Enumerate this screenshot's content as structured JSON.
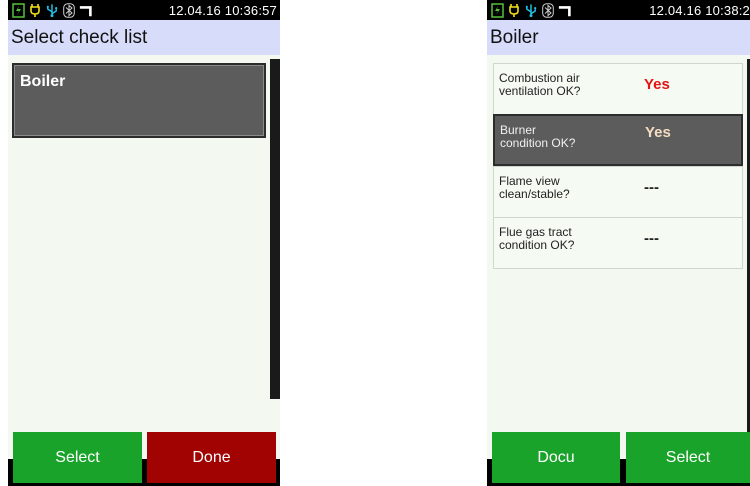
{
  "colors": {
    "green_button": "#1aa32a",
    "red_button": "#a10303",
    "title_bar": "#d8dcfb",
    "content_bg": "#f3f8f1",
    "answer_yes": "#e41414",
    "selected_row": "#5c5c5c"
  },
  "left_screen": {
    "status_icons": [
      "battery-charging-icon",
      "plug-icon",
      "usb-icon",
      "bluetooth-icon",
      "probe-icon"
    ],
    "datetime": "12.04.16 10:36:57",
    "title": "Select check list",
    "items": [
      {
        "label": "Boiler",
        "selected": true
      }
    ],
    "softkeys": {
      "left": "Select",
      "right": "Done"
    }
  },
  "right_screen": {
    "status_icons": [
      "battery-charging-icon",
      "plug-icon",
      "usb-icon",
      "bluetooth-icon",
      "probe-icon"
    ],
    "datetime": "12.04.16 10:38:2",
    "title": "Boiler",
    "checklist": [
      {
        "question_line1": "Combustion air",
        "question_line2": "ventilation OK?",
        "answer": "Yes",
        "selected": false
      },
      {
        "question_line1": "Burner",
        "question_line2": "condition OK?",
        "answer": "Yes",
        "selected": true
      },
      {
        "question_line1": "Flame view",
        "question_line2": "clean/stable?",
        "answer": "---",
        "selected": false
      },
      {
        "question_line1": "Flue gas tract",
        "question_line2": "condition OK?",
        "answer": "---",
        "selected": false
      }
    ],
    "softkeys": {
      "left": "Docu",
      "right": "Select"
    }
  }
}
